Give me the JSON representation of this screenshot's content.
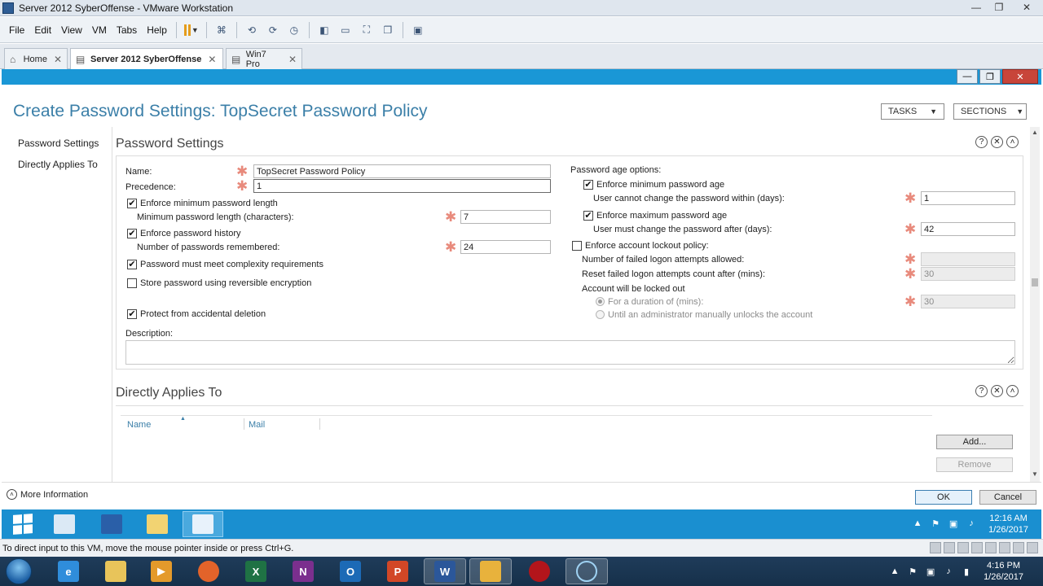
{
  "vm_window": {
    "title": "Server 2012 SyberOffense - VMware Workstation",
    "menu": [
      "File",
      "Edit",
      "View",
      "VM",
      "Tabs",
      "Help"
    ],
    "tabs": [
      {
        "label": "Home",
        "active": false
      },
      {
        "label": "Server 2012 SyberOffense",
        "active": true
      },
      {
        "label": "Win7 Pro",
        "active": false
      }
    ],
    "status_message": "To direct input to this VM, move the mouse pointer inside or press Ctrl+G."
  },
  "dialog": {
    "title": "Create Password Settings: TopSecret Password Policy",
    "tasks_label": "TASKS",
    "sections_label": "SECTIONS",
    "nav": [
      "Password Settings",
      "Directly Applies To"
    ],
    "password_settings": {
      "header": "Password Settings",
      "name_label": "Name:",
      "name_value": "TopSecret Password Policy",
      "precedence_label": "Precedence:",
      "precedence_value": "1",
      "enforce_min_length": {
        "label": "Enforce minimum password length",
        "checked": true
      },
      "min_length_label": "Minimum password length (characters):",
      "min_length_value": "7",
      "enforce_history": {
        "label": "Enforce password history",
        "checked": true
      },
      "history_label": "Number of passwords remembered:",
      "history_value": "24",
      "complexity": {
        "label": "Password must meet complexity requirements",
        "checked": true
      },
      "reversible": {
        "label": "Store password using reversible encryption",
        "checked": false
      },
      "protect": {
        "label": "Protect from accidental deletion",
        "checked": true
      },
      "description_label": "Description:",
      "age_options_label": "Password age options:",
      "enforce_min_age": {
        "label": "Enforce minimum password age",
        "checked": true
      },
      "min_age_label": "User cannot change the password within (days):",
      "min_age_value": "1",
      "enforce_max_age": {
        "label": "Enforce maximum password age",
        "checked": true
      },
      "max_age_label": "User must change the password after (days):",
      "max_age_value": "42",
      "lockout": {
        "label": "Enforce account lockout policy:",
        "checked": false
      },
      "failed_attempts_label": "Number of failed logon attempts allowed:",
      "failed_attempts_value": "",
      "reset_label": "Reset failed logon attempts count after (mins):",
      "reset_value": "30",
      "locked_out_label": "Account will be locked out",
      "duration_label": "For a duration of (mins):",
      "duration_value": "30",
      "until_admin_label": "Until an administrator manually unlocks the account"
    },
    "applies_to": {
      "header": "Directly Applies To",
      "columns": [
        "Name",
        "Mail"
      ],
      "add_label": "Add...",
      "remove_label": "Remove"
    },
    "more_info": "More Information",
    "ok_label": "OK",
    "cancel_label": "Cancel"
  },
  "guest_taskbar": {
    "time": "12:16 AM",
    "date": "1/26/2017"
  },
  "host_taskbar": {
    "time": "4:16 PM",
    "date": "1/26/2017"
  }
}
